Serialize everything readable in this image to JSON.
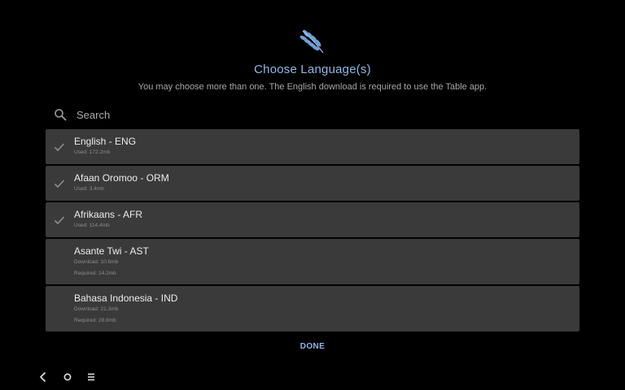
{
  "header": {
    "logo_icon": "wheat-logo-icon",
    "title": "Choose Language(s)",
    "subtitle": "You may choose more than one. The English download is required to use the Table app."
  },
  "search": {
    "placeholder": "Search",
    "value": ""
  },
  "languages": [
    {
      "name": "English - ENG",
      "used": "Used: 172.2mb",
      "installed": true
    },
    {
      "name": "Afaan Oromoo - ORM",
      "used": "Used: 3.4mb",
      "installed": true
    },
    {
      "name": "Afrikaans - AFR",
      "used": "Used: 114.4mb",
      "installed": true
    },
    {
      "name": "Asante Twi - AST",
      "download": "Download: 10.6mb",
      "required": "Required: 14.2mb",
      "installed": false
    },
    {
      "name": "Bahasa Indonesia - IND",
      "download": "Download: 21.3mb",
      "required": "Required: 28.8mb",
      "installed": false
    }
  ],
  "actions": {
    "done_label": "DONE"
  },
  "nav": {
    "back_icon": "back-icon",
    "home_icon": "home-icon",
    "menu_icon": "menu-icon"
  },
  "colors": {
    "accent": "#8fb7e6",
    "background": "#000000",
    "item_background": "#3a3a3a"
  }
}
